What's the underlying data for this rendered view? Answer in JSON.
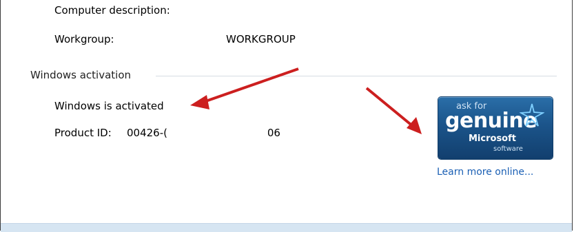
{
  "system": {
    "computer_description_label": "Computer description:",
    "workgroup_label": "Workgroup:",
    "workgroup_value": "WORKGROUP"
  },
  "activation": {
    "section_title": "Windows activation",
    "status": "Windows is activated",
    "product_id_label": "Product ID:",
    "product_id_prefix": "00426-(",
    "product_id_suffix": ")06"
  },
  "genuine_badge": {
    "line1": "ask for",
    "line2": "genuine",
    "line3": "Microsoft",
    "line4": "software",
    "icon": "star-icon"
  },
  "learn_more_link": "Learn more online...",
  "colors": {
    "arrow": "#cc1f1f",
    "link": "#1a5fb4",
    "badge_bg": "#1b548a"
  }
}
